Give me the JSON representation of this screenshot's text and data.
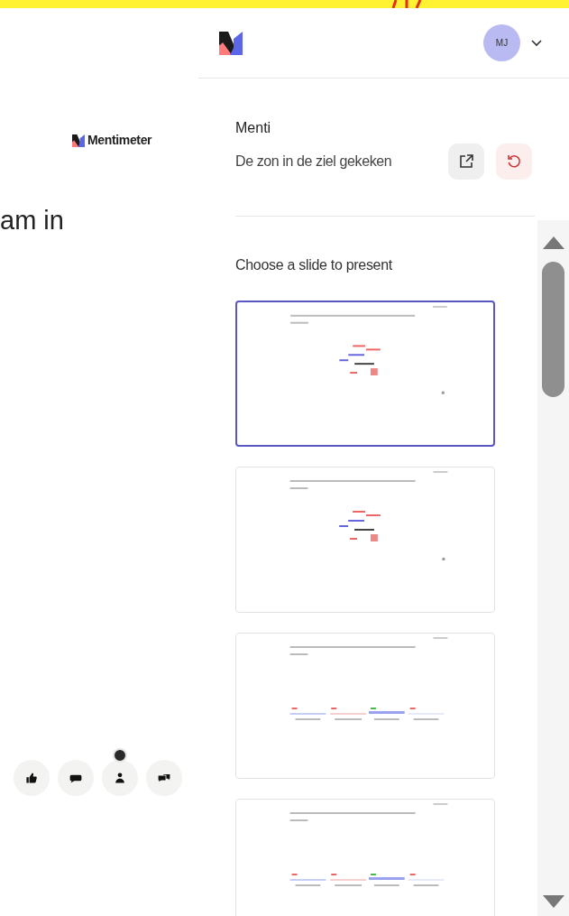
{
  "left_panel": {
    "brand": "Mentimeter",
    "heading_fragment": "am in",
    "reactions": [
      {
        "kind": "thumbs-up"
      },
      {
        "kind": "comment"
      },
      {
        "kind": "audience",
        "badge": true
      },
      {
        "kind": "questions"
      }
    ]
  },
  "header": {
    "avatar": "MJ"
  },
  "presentation": {
    "owner": "Menti",
    "title": "De zon in de ziel gekeken"
  },
  "slide_picker": {
    "heading": "Choose a slide to present",
    "slides": [
      {
        "kind": "wordcloud",
        "selected": true
      },
      {
        "kind": "wordcloud",
        "selected": false
      },
      {
        "kind": "bars",
        "selected": false
      },
      {
        "kind": "bars",
        "selected": false
      }
    ]
  }
}
